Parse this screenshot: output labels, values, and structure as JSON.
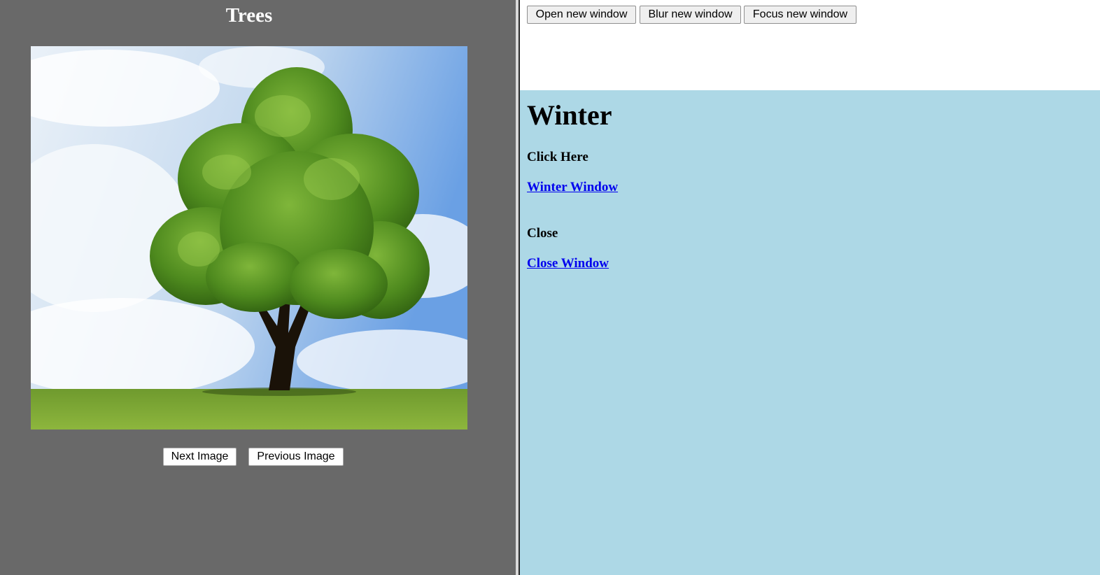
{
  "left_frame": {
    "title": "Trees",
    "image": {
      "subject": "tree-in-field"
    },
    "next_label": "Next Image",
    "prev_label": "Previous Image",
    "background_color": "#696969"
  },
  "top_frame": {
    "open_label": "Open new window",
    "blur_label": "Blur new window",
    "focus_label": "Focus new window"
  },
  "bottom_frame": {
    "heading": "Winter",
    "click_heading": "Click Here",
    "winter_link": "Winter Window",
    "close_heading": "Close",
    "close_link": "Close Window",
    "background_color": "#add8e6",
    "link_color": "#0000ee"
  }
}
